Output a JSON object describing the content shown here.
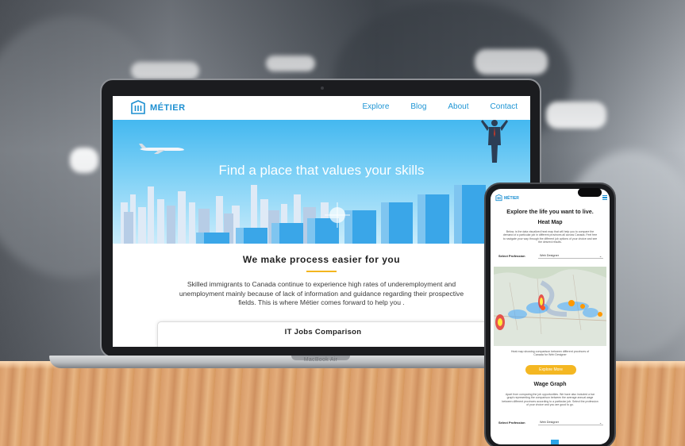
{
  "laptop": {
    "brand_label": "MacBook Air",
    "site": {
      "logo_text": "MÉTIER",
      "nav": [
        "Explore",
        "Blog",
        "About",
        "Contact"
      ],
      "hero_title": "Find a place that values your skills",
      "section_title": "We make process easier for you",
      "section_text": "Skilled immigrants to Canada continue to experience high rates of underemployment and unemployment mainly because of lack of information and guidance regarding their prospective fields. This is where Métier comes forward to help you .",
      "card_title": "IT Jobs Comparison"
    }
  },
  "phone": {
    "logo_text": "MÉTIER",
    "explore_title": "Explore the life you want to live.",
    "heat_map_title": "Heat Map",
    "heat_map_desc": "Below, is the data visualized heat map that will help you to compare the demand of a particular job in different provinces all across Canada. Feel free to navigate your way through the different job options of your choice and see the desired results.",
    "select_label": "Select Profession",
    "select_value": "Web Designer",
    "map_caption": "Heat map showing comparison between different provinces of Canada for Web Designer",
    "button_label": "Explore More",
    "wage_title": "Wage Graph",
    "wage_desc": "Apart from comparing the job opportunities. We have also included a bar graph representing the comparison between the average annual wage between different provinces according to a particular job. Select the profession of your choice and you are good to go.",
    "select2_label": "Select Profession",
    "select2_value": "Web Designer"
  },
  "colors": {
    "brand_blue": "#1c8fd1",
    "accent_yellow": "#f4b722",
    "hero_sky": "#44b8f0"
  }
}
